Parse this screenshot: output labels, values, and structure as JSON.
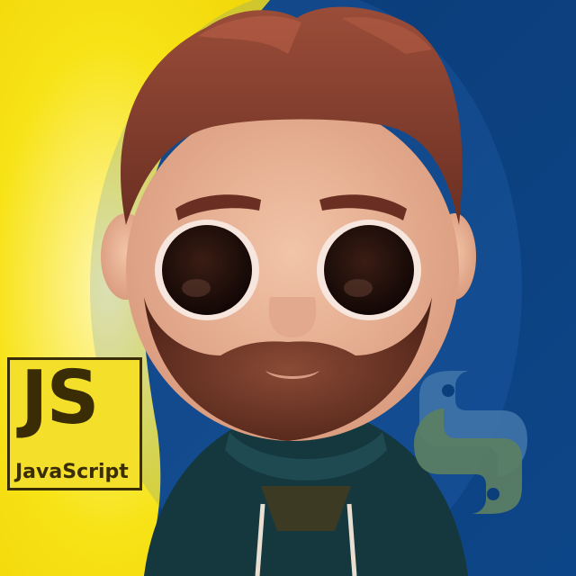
{
  "badge": {
    "logo_letters": "JS",
    "logo_word": "JavaScript",
    "colors": {
      "background": "#f4e02a",
      "ink": "#3a2c05"
    }
  },
  "background": {
    "left_color": "#f7e317",
    "right_color": "#0b3f7c"
  },
  "python_logo": {
    "icon": "python-logo-icon",
    "colors": [
      "#3f74a8",
      "#5d7f62"
    ]
  }
}
